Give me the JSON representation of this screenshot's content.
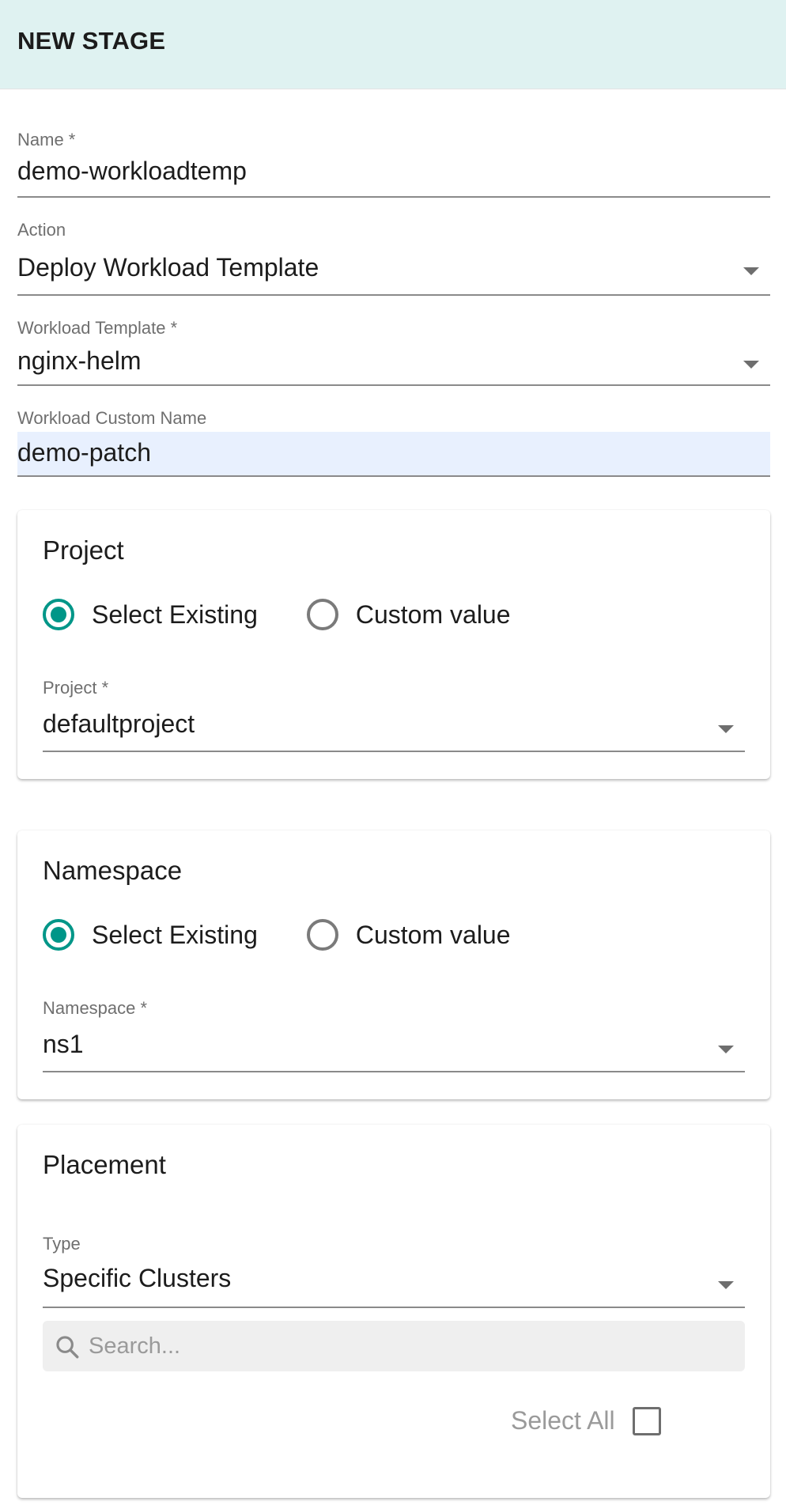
{
  "header": {
    "title": "NEW STAGE"
  },
  "form": {
    "name": {
      "label": "Name *",
      "value": "demo-workloadtemp"
    },
    "action": {
      "label": "Action",
      "value": "Deploy Workload Template"
    },
    "workload_template": {
      "label": "Workload Template *",
      "value": "nginx-helm"
    },
    "workload_custom_name": {
      "label": "Workload Custom Name",
      "value": "demo-patch"
    }
  },
  "project_card": {
    "title": "Project",
    "radios": [
      {
        "label": "Select Existing",
        "checked": true
      },
      {
        "label": "Custom value",
        "checked": false
      }
    ],
    "select": {
      "label": "Project *",
      "value": "defaultproject"
    }
  },
  "namespace_card": {
    "title": "Namespace",
    "radios": [
      {
        "label": "Select Existing",
        "checked": true
      },
      {
        "label": "Custom value",
        "checked": false
      }
    ],
    "select": {
      "label": "Namespace *",
      "value": "ns1"
    }
  },
  "placement_card": {
    "title": "Placement",
    "type": {
      "label": "Type",
      "value": "Specific Clusters"
    },
    "search": {
      "placeholder": "Search...",
      "value": ""
    },
    "select_all": {
      "label": "Select All",
      "checked": false
    }
  },
  "colors": {
    "header_bg": "#dff2f1",
    "accent": "#009688",
    "autofill_bg": "#e8f0fe"
  },
  "icons": {
    "dropdown": "caret-down-icon",
    "search": "search-icon",
    "radio_checked": "radio-checked-icon",
    "radio_unchecked": "radio-unchecked-icon",
    "checkbox": "checkbox-unchecked-icon"
  }
}
